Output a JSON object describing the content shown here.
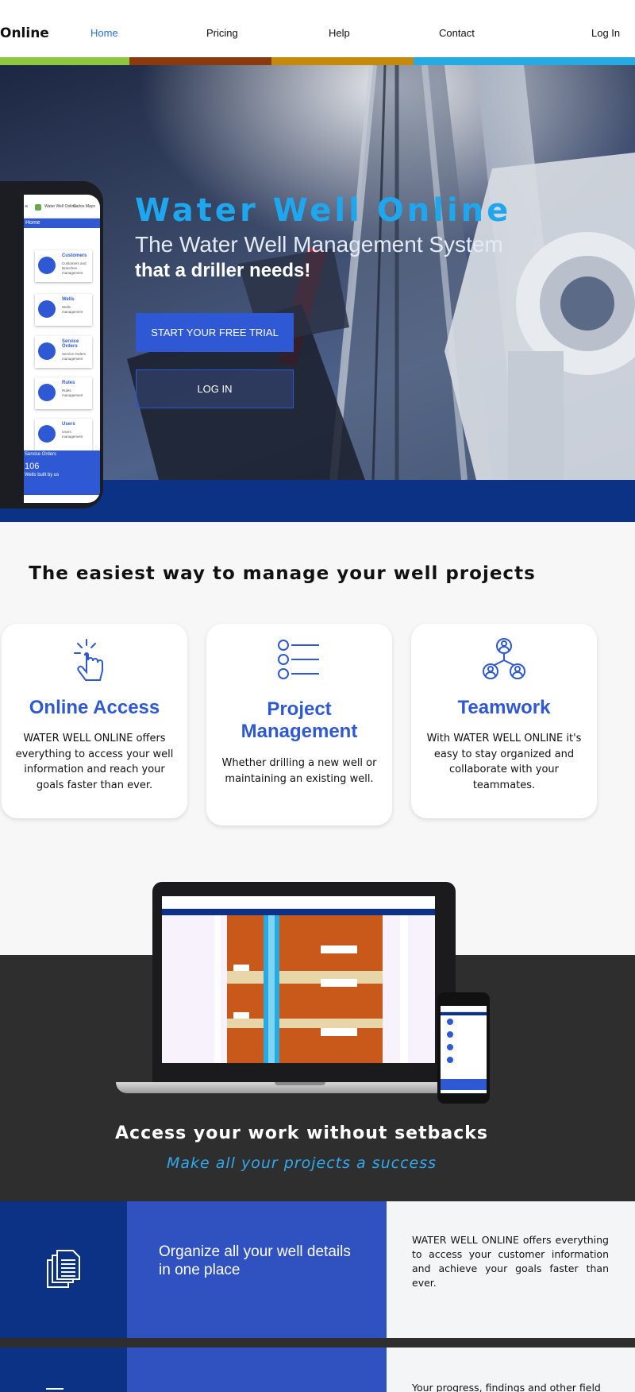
{
  "nav": {
    "brand": "Online",
    "links": [
      "Home",
      "Pricing",
      "Help",
      "Contact",
      "Log In"
    ],
    "active": "Home"
  },
  "colors": {
    "stripes": [
      "#8dc63f",
      "#8b3a0f",
      "#c48a0d",
      "#27aae1"
    ],
    "primary": "#2f59d4",
    "title_blue": "#1ea7ee",
    "hero_band": "#0b3284",
    "dark_band": "#2e2e2e"
  },
  "hero": {
    "title": "Water Well Online",
    "subtitle": "The Water Well Management System",
    "subtitle_bold": "that a driller needs!",
    "trial_button": "Start your free trial",
    "login_button": "Log in"
  },
  "phone_mockup": {
    "app_name": "Water Well Online",
    "user": "Carlos Mayo",
    "home": "Home",
    "cards": [
      {
        "title": "Customers",
        "desc": "Customers and Branches management",
        "icon": "customers-icon"
      },
      {
        "title": "Wells",
        "desc": "Wells management",
        "icon": "well-icon"
      },
      {
        "title": "Service Orders",
        "desc": "Service Orders management",
        "icon": "service-orders-icon"
      },
      {
        "title": "Rules",
        "desc": "Rules management",
        "icon": "rules-icon"
      },
      {
        "title": "Users",
        "desc": "Users management",
        "icon": "users-icon"
      }
    ],
    "bottom_title": "Service Orders",
    "bottom_count": "106",
    "bottom_sub": "Wells built by us"
  },
  "features": {
    "heading": "The easiest way to manage your well projects",
    "cards": [
      {
        "title": "Online Access",
        "desc": "WATER WELL ONLINE offers everything to access your well information and reach your goals faster than ever.",
        "icon": "pointer-click-icon"
      },
      {
        "title": "Project Management",
        "desc": "Whether drilling a new well or maintaining an existing well.",
        "icon": "list-icon"
      },
      {
        "title": "Teamwork",
        "desc": "With WATER WELL ONLINE it's easy to stay organized and collaborate with your teammates.",
        "icon": "team-icon"
      }
    ]
  },
  "devices": {
    "title": "Access your work without setbacks",
    "subtitle": "Make all your projects a success"
  },
  "benefits": [
    {
      "title": "Organize all your well details in one place",
      "desc": "WATER WELL ONLINE offers everything to access your customer information and achieve your goals faster than ever.",
      "icon": "documents-icon"
    },
    {
      "title": "",
      "desc": "Your progress, findings and other field",
      "icon": "document-icon"
    }
  ]
}
